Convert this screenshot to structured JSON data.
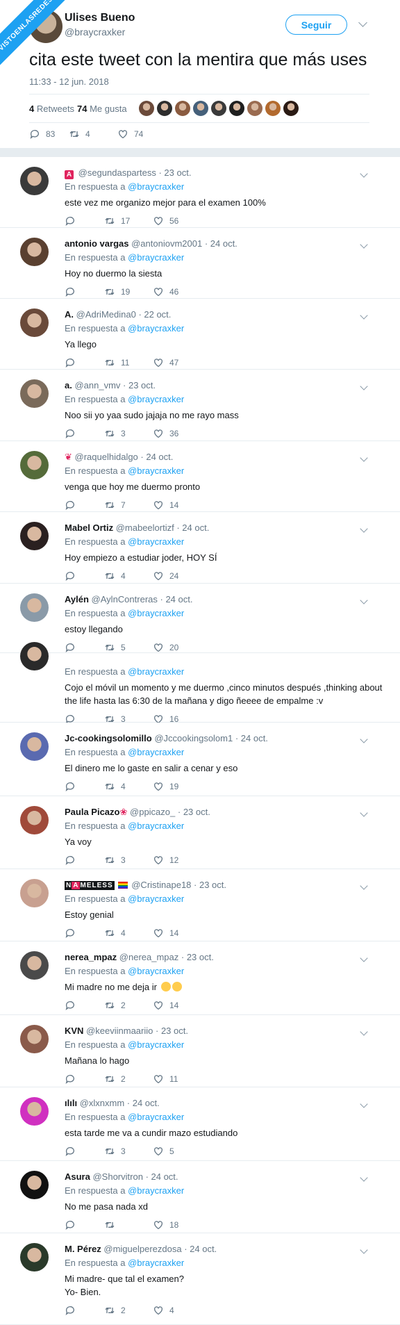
{
  "watermark": "VISTOENLASREDES",
  "tweet": {
    "name": "Ulises Bueno",
    "handle": "@braycraxker",
    "follow_label": "Seguir",
    "text": "cita este tweet con la mentira que más uses",
    "datetime": "11:33 - 12 jun. 2018",
    "retweets_count": "4",
    "retweets_label": "Retweets",
    "likes_count": "74",
    "likes_label": "Me gusta",
    "reply_count": "83",
    "retweet_count": "4",
    "like_count": "74",
    "liker_colors": [
      "#6b4a3a",
      "#2d2d2d",
      "#8a5b40",
      "#45607a",
      "#3a3a3a",
      "#1f1f1f",
      "#9a6b50",
      "#b36a2e",
      "#2a1a14"
    ]
  },
  "reply_context": {
    "prefix": "En respuesta a",
    "target": "@braycraxker"
  },
  "replies": [
    {
      "name": "",
      "logo": "A",
      "handle": "@segundaspartess",
      "date": "· 23 oct.",
      "text": "este vez me organizo mejor para el examen 100%",
      "replies": "",
      "retweets": "17",
      "likes": "56",
      "avatar": "#3a3a3a"
    },
    {
      "name": "antonio vargas",
      "handle": "@antoniovm2001",
      "date": "· 24 oct.",
      "text": "Hoy no duermo la siesta",
      "replies": "",
      "retweets": "19",
      "likes": "46",
      "avatar": "#5a4030"
    },
    {
      "name": "A.",
      "handle": "@AdriMedina0",
      "date": "· 22 oct.",
      "text": "Ya llego",
      "replies": "",
      "retweets": "11",
      "likes": "47",
      "avatar": "#6a4a3a"
    },
    {
      "name": "a.",
      "handle": "@ann_vmv",
      "date": "· 23 oct.",
      "text": "Noo sii yo yaa sudo jajaja no me rayo mass",
      "replies": "",
      "retweets": "3",
      "likes": "36",
      "avatar": "#7a6a5a"
    },
    {
      "name": "",
      "logo2": "flower",
      "handle": "@raquelhidalgo",
      "date": "· 24 oct.",
      "text": "venga que hoy me duermo pronto",
      "replies": "",
      "retweets": "7",
      "likes": "14",
      "avatar": "#556b3a"
    },
    {
      "name": "Mabel Ortiz",
      "handle": "@mabeelortizf",
      "date": "· 24 oct.",
      "text": "Hoy empiezo a estudiar joder, HOY SÍ",
      "replies": "",
      "retweets": "4",
      "likes": "24",
      "avatar": "#2a2020"
    },
    {
      "name": "Aylén",
      "handle": "@AylnContreras",
      "date": "· 24 oct.",
      "text": "estoy llegando",
      "replies": "",
      "retweets": "5",
      "likes": "20",
      "avatar": "#8a9aa8"
    },
    {
      "name": "",
      "handle": "",
      "date": "",
      "text": "Cojo el móvil un momento y me duermo ,cinco minutos después ,thinking about\nthe life hasta las 6:30 de la mañana y digo ñeeee de empalme :v",
      "replies": "",
      "retweets": "3",
      "likes": "16",
      "avatar": "#2a2a2a",
      "partial": true
    },
    {
      "name": "Jc-cookingsolomillo",
      "handle": "@Jccookingsolom1",
      "date": "· 24 oct.",
      "text": "El dinero me lo gaste en salir a cenar y eso",
      "replies": "",
      "retweets": "4",
      "likes": "19",
      "avatar": "#5a6ab0"
    },
    {
      "name": "Paula Picazo",
      "flower": "❀",
      "handle": "@ppicazo_",
      "date": "· 23 oct.",
      "text": "Ya voy",
      "replies": "",
      "retweets": "3",
      "likes": "12",
      "avatar": "#a04a3a"
    },
    {
      "name": "",
      "nameless": [
        "N",
        "A",
        "M",
        "E",
        "L",
        "E",
        "S",
        "S"
      ],
      "handle": "@Cristinape18",
      "date": "· 23 oct.",
      "text": "Estoy genial",
      "replies": "",
      "retweets": "4",
      "likes": "14",
      "avatar": "#c8a090"
    },
    {
      "name": "nerea_mpaz",
      "handle": "@nerea_mpaz",
      "date": "· 23 oct.",
      "text": "Mi madre no me deja ir",
      "emoji": "😂😂",
      "replies": "",
      "retweets": "2",
      "likes": "14",
      "avatar": "#4a4a4a"
    },
    {
      "name": "KVN",
      "handle": "@keeviinmaariio",
      "date": "· 23 oct.",
      "text": "Mañana lo hago",
      "replies": "",
      "retweets": "2",
      "likes": "11",
      "avatar": "#8a5a4a"
    },
    {
      "name": "ılılı",
      "handle": "@xlxnxmm",
      "date": "· 24 oct.",
      "text": "esta tarde me va a cundir mazo estudiando",
      "replies": "",
      "retweets": "3",
      "likes": "5",
      "avatar": "#d030c0"
    },
    {
      "name": "Asura",
      "handle": "@Shorvitron",
      "date": "· 24 oct.",
      "text": "No me pasa nada xd",
      "replies": "",
      "retweets": "",
      "likes": "18",
      "avatar": "#111111"
    },
    {
      "name": "M. Pérez",
      "handle": "@miguelperezdosa",
      "date": "· 24 oct.",
      "text": "Mi madre- que tal el examen?\nYo- Bien.",
      "replies": "",
      "retweets": "2",
      "likes": "4",
      "avatar": "#2a3a2a"
    }
  ]
}
